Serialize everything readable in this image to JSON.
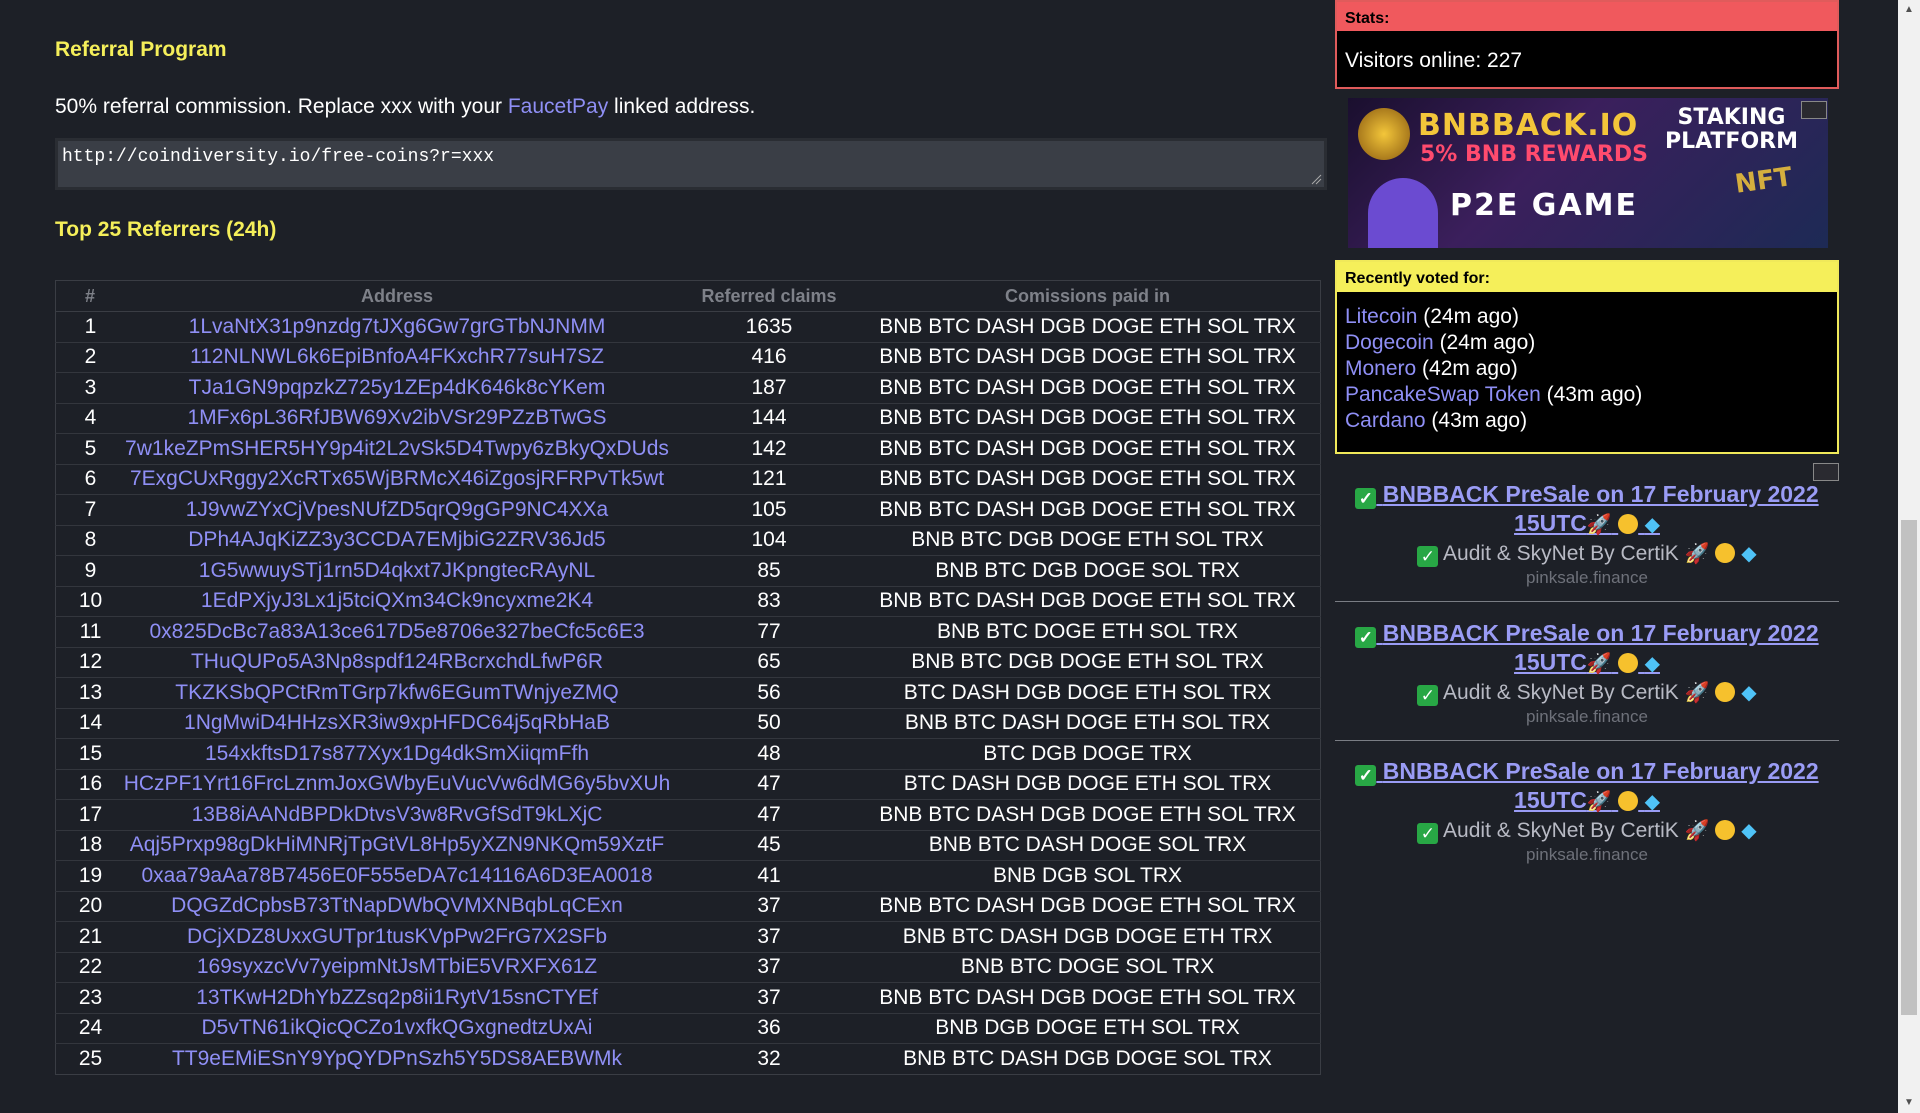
{
  "referral": {
    "title": "Referral Program",
    "desc_prefix": "50% referral commission. Replace xxx with your ",
    "desc_link": "FaucetPay",
    "desc_suffix": " linked address.",
    "url": "http://coindiversity.io/free-coins?r=xxx"
  },
  "top": {
    "title": "Top 25 Referrers (24h)",
    "columns": [
      "#",
      "Address",
      "Referred claims",
      "Comissions paid in"
    ],
    "rows": [
      {
        "n": "1",
        "addr": "1LvaNtX31p9nzdg7tJXg6Gw7grGTbNJNMM",
        "claims": "1635",
        "coins": "BNB BTC DASH DGB DOGE ETH SOL TRX"
      },
      {
        "n": "2",
        "addr": "112NLNWL6k6EpiBnfoA4FKxchR77suH7SZ",
        "claims": "416",
        "coins": "BNB BTC DASH DGB DOGE ETH SOL TRX"
      },
      {
        "n": "3",
        "addr": "TJa1GN9pqpzkZ725y1ZEp4dK646k8cYKem",
        "claims": "187",
        "coins": "BNB BTC DASH DGB DOGE ETH SOL TRX"
      },
      {
        "n": "4",
        "addr": "1MFx6pL36RfJBW69Xv2ibVSr29PZzBTwGS",
        "claims": "144",
        "coins": "BNB BTC DASH DGB DOGE ETH SOL TRX"
      },
      {
        "n": "5",
        "addr": "7w1keZPmSHER5HY9p4it2L2vSk5D4Twpy6zBkyQxDUds",
        "claims": "142",
        "coins": "BNB BTC DASH DGB DOGE ETH SOL TRX"
      },
      {
        "n": "6",
        "addr": "7ExgCUxRggy2XcRTx65WjBRMcX46iZgosjRFRPvTk5wt",
        "claims": "121",
        "coins": "BNB BTC DASH DGB DOGE ETH SOL TRX"
      },
      {
        "n": "7",
        "addr": "1J9vwZYxCjVpesNUfZD5qrQ9gGP9NC4XXa",
        "claims": "105",
        "coins": "BNB BTC DASH DGB DOGE ETH SOL TRX"
      },
      {
        "n": "8",
        "addr": "DPh4AJqKiZZ3y3CCDA7EMjbiG2ZRV36Jd5",
        "claims": "104",
        "coins": "BNB BTC DGB DOGE ETH SOL TRX"
      },
      {
        "n": "9",
        "addr": "1G5wwuySTj1rn5D4qkxt7JKpngtecRAyNL",
        "claims": "85",
        "coins": "BNB BTC DGB DOGE SOL TRX"
      },
      {
        "n": "10",
        "addr": "1EdPXjyJ3Lx1j5tciQXm34Ck9ncyxme2K4",
        "claims": "83",
        "coins": "BNB BTC DASH DGB DOGE ETH SOL TRX"
      },
      {
        "n": "11",
        "addr": "0x825DcBc7a83A13ce617D5e8706e327beCfc5c6E3",
        "claims": "77",
        "coins": "BNB BTC DOGE ETH SOL TRX"
      },
      {
        "n": "12",
        "addr": "THuQUPo5A3Np8spdf124RBcrxchdLfwP6R",
        "claims": "65",
        "coins": "BNB BTC DGB DOGE ETH SOL TRX"
      },
      {
        "n": "13",
        "addr": "TKZKSbQPCtRmTGrp7kfw6EGumTWnjyeZMQ",
        "claims": "56",
        "coins": "BTC DASH DGB DOGE ETH SOL TRX"
      },
      {
        "n": "14",
        "addr": "1NgMwiD4HHzsXR3iw9xpHFDC64j5qRbHaB",
        "claims": "50",
        "coins": "BNB BTC DASH DOGE ETH SOL TRX"
      },
      {
        "n": "15",
        "addr": "154xkftsD17s877Xyx1Dg4dkSmXiiqmFfh",
        "claims": "48",
        "coins": "BTC DGB DOGE TRX"
      },
      {
        "n": "16",
        "addr": "HCzPF1Yrt16FrcLznmJoxGWbyEuVucVw6dMG6y5bvXUh",
        "claims": "47",
        "coins": "BTC DASH DGB DOGE ETH SOL TRX"
      },
      {
        "n": "17",
        "addr": "13B8iAANdBPDkDtvsV3w8RvGfSdT9kLXjC",
        "claims": "47",
        "coins": "BNB BTC DASH DGB DOGE ETH SOL TRX"
      },
      {
        "n": "18",
        "addr": "Aqj5Prxp98gDkHiMNRjTpGtVL8Hp5yXZN9NKQm59XztF",
        "claims": "45",
        "coins": "BNB BTC DASH DOGE SOL TRX"
      },
      {
        "n": "19",
        "addr": "0xaa79aAa78B7456E0F555eDA7c14116A6D3EA0018",
        "claims": "41",
        "coins": "BNB DGB SOL TRX"
      },
      {
        "n": "20",
        "addr": "DQGZdCpbsB73TtNapDWbQVMXNBqbLqCExn",
        "claims": "37",
        "coins": "BNB BTC DASH DGB DOGE ETH SOL TRX"
      },
      {
        "n": "21",
        "addr": "DCjXDZ8UxxGUTpr1tusKVpPw2FrG7X2SFb",
        "claims": "37",
        "coins": "BNB BTC DASH DGB DOGE ETH TRX"
      },
      {
        "n": "22",
        "addr": "169syxzcVv7yeipmNtJsMTbiE5VRXFX61Z",
        "claims": "37",
        "coins": "BNB BTC DOGE SOL TRX"
      },
      {
        "n": "23",
        "addr": "13TKwH2DhYbZZsq2p8ii1RytV15snCTYEf",
        "claims": "37",
        "coins": "BNB BTC DASH DGB DOGE ETH SOL TRX"
      },
      {
        "n": "24",
        "addr": "D5vTN61ikQicQCZo1vxfkQGxgnedtzUxAi",
        "claims": "36",
        "coins": "BNB DGB DOGE ETH SOL TRX"
      },
      {
        "n": "25",
        "addr": "TT9eEMiESnY9YpQYDPnSzh5Y5DS8AEBWMk",
        "claims": "32",
        "coins": "BNB BTC DASH DGB DOGE SOL TRX"
      }
    ]
  },
  "stats": {
    "header": "Stats:",
    "visitors": "Visitors online: 227"
  },
  "banner": {
    "title": "BNBBACK.IO",
    "rewards": "5% BNB REWARDS",
    "staking_line1": "STAKING",
    "staking_line2": "PLATFORM",
    "game": "P2E GAME",
    "nft": "NFT"
  },
  "voted": {
    "header": "Recently voted for:",
    "items": [
      {
        "name": "Litecoin",
        "time": " (24m ago)"
      },
      {
        "name": "Dogecoin",
        "time": " (24m ago)"
      },
      {
        "name": "Monero",
        "time": " (42m ago)"
      },
      {
        "name": "PancakeSwap Token",
        "time": " (43m ago)"
      },
      {
        "name": "Cardano",
        "time": " (43m ago)"
      }
    ]
  },
  "promos": [
    {
      "line1": "BNBBACK PreSale on 17 February 2022",
      "line2": "15UTC",
      "audit": "Audit & SkyNet By CertiK",
      "site": "pinksale.finance"
    },
    {
      "line1": "BNBBACK PreSale on 17 February 2022",
      "line2": "15UTC",
      "audit": "Audit & SkyNet By CertiK",
      "site": "pinksale.finance"
    },
    {
      "line1": "BNBBACK PreSale on 17 February 2022",
      "line2": "15UTC",
      "audit": "Audit & SkyNet By CertiK",
      "site": "pinksale.finance"
    }
  ],
  "icons": {
    "check": "check-mark-icon",
    "rocket": "rocket-icon",
    "coin": "coin-icon",
    "gem": "gem-icon"
  },
  "colors": {
    "background": "#1d2027",
    "heading": "#f5ef5a",
    "link": "#8f8ff5",
    "stats_accent": "#f0595d",
    "voted_accent": "#f5ef5a",
    "promo_link": "#9a9cf5"
  }
}
